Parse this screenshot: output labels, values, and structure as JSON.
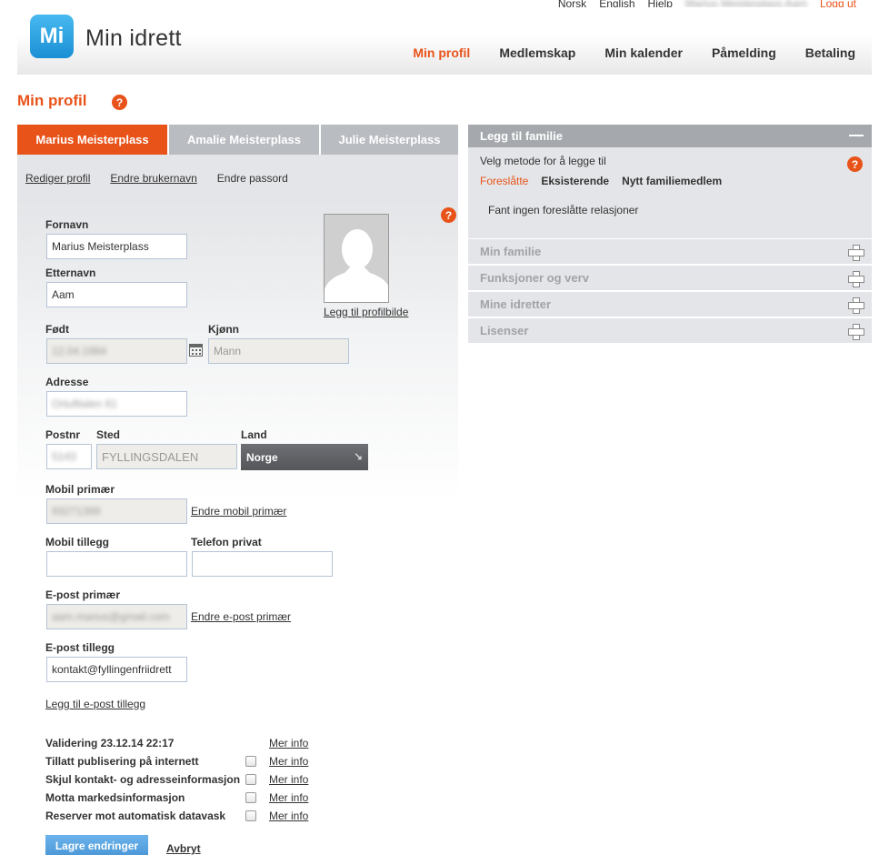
{
  "topbar": {
    "lang_no": "Norsk",
    "lang_en": "English",
    "help": "Hjelp",
    "user": "Marius Meisterplass Aam",
    "logout": "Logg ut"
  },
  "brand": {
    "badge": "Mi",
    "name": "Min idrett"
  },
  "nav": {
    "items": [
      "Min profil",
      "Medlemskap",
      "Min kalender",
      "Påmelding",
      "Betaling"
    ],
    "active_color": "#e8531a"
  },
  "page": {
    "title": "Min profil",
    "help": "?"
  },
  "tabs": [
    "Marius Meisterplass",
    "Amalie Meisterplass",
    "Julie Meisterplass"
  ],
  "profile_links": {
    "edit_profile": "Rediger profil",
    "change_username": "Endre brukernavn",
    "change_password": "Endre passord"
  },
  "form": {
    "first_name_label": "Fornavn",
    "first_name": "Marius Meisterplass",
    "last_name_label": "Etternavn",
    "last_name": "Aam",
    "add_photo": "Legg til profilbilde",
    "born_label": "Født",
    "born": "12.04.1984",
    "gender_label": "Kjønn",
    "gender": "Mann",
    "address_label": "Adresse",
    "address": "Ortufitalen 61",
    "postnr_label": "Postnr",
    "postnr": "5143",
    "place_label": "Sted",
    "place": "FYLLINGSDALEN",
    "country_label": "Land",
    "country": "Norge",
    "mobile_primary_label": "Mobil primær",
    "mobile_primary": "93271399",
    "change_mobile": "Endre mobil primær",
    "mobile_extra_label": "Mobil tillegg",
    "mobile_extra": "",
    "phone_private_label": "Telefon privat",
    "phone_private": "",
    "email_primary_label": "E-post primær",
    "email_primary": "aam.marius@gmail.com",
    "change_email": "Endre e-post primær",
    "email_extra_label": "E-post tillegg",
    "email_extra": "kontakt@fyllingenfriidrett",
    "add_email": "Legg til e-post tillegg"
  },
  "settings": {
    "validation": "Validering 23.12.14 22:17",
    "more_info": "Mer info",
    "rows": [
      "Tillatt publisering på internett",
      "Skjul kontakt- og adresseinformasjon",
      "Motta markedsinformasjon",
      "Reserver mot automatisk datavask"
    ]
  },
  "actions": {
    "save": "Lagre endringer",
    "cancel": "Avbryt"
  },
  "family": {
    "title": "Legg til familie",
    "method_text": "Velg metode for å legge til",
    "methods": [
      "Foreslåtte",
      "Eksisterende",
      "Nytt familiemedlem"
    ],
    "empty": "Fant ingen foreslåtte relasjoner",
    "sections": [
      "Min familie",
      "Funksjoner og verv",
      "Mine idretter",
      "Lisenser"
    ]
  }
}
